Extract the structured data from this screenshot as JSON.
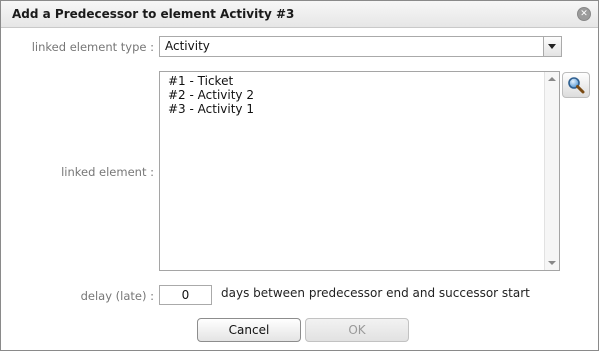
{
  "dialog": {
    "title": "Add a Predecessor to element Activity #3",
    "close_icon": "close-icon"
  },
  "form": {
    "type_label": "linked element type :",
    "type_value": "Activity",
    "element_label": "linked element :",
    "elements": [
      "#1 - Ticket",
      "#2 - Activity 2",
      "#3 - Activity 1"
    ],
    "delay_label": "delay (late) :",
    "delay_value": "0",
    "delay_suffix": "days between predecessor end and successor start",
    "search_icon": "magnifier-icon"
  },
  "buttons": {
    "cancel": "Cancel",
    "ok": "OK"
  }
}
